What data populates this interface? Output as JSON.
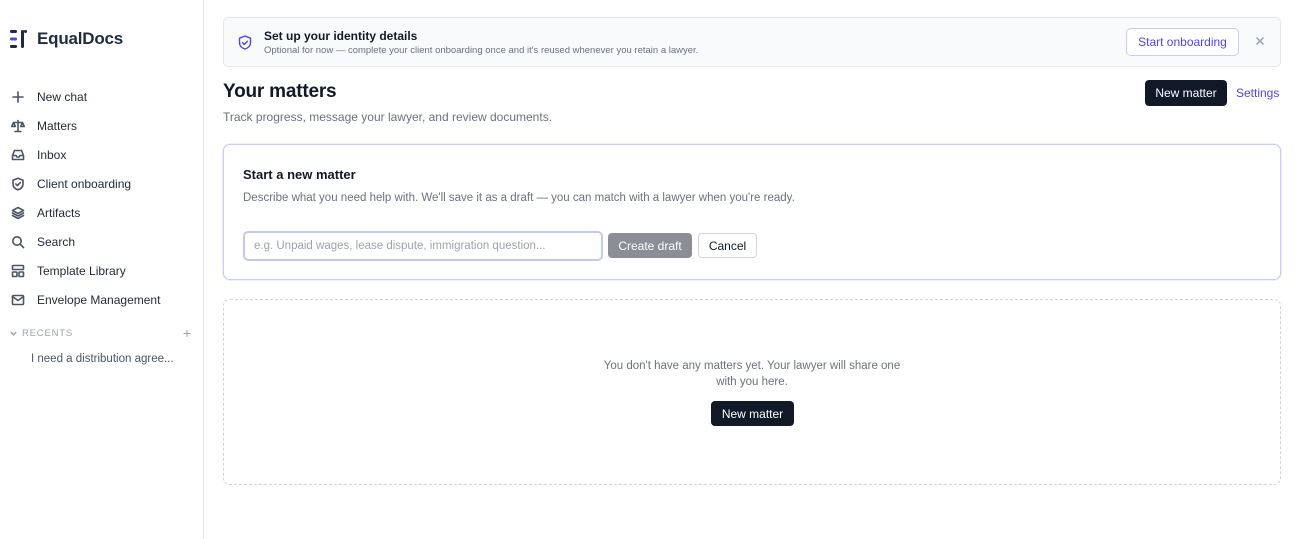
{
  "brand": {
    "name": "EqualDocs"
  },
  "sidebar": {
    "items": [
      {
        "label": "New chat",
        "icon": "plus-icon"
      },
      {
        "label": "Matters",
        "icon": "scale-icon"
      },
      {
        "label": "Inbox",
        "icon": "inbox-icon"
      },
      {
        "label": "Client onboarding",
        "icon": "shield-icon"
      },
      {
        "label": "Artifacts",
        "icon": "layers-icon"
      },
      {
        "label": "Search",
        "icon": "search-icon"
      },
      {
        "label": "Template Library",
        "icon": "template-icon"
      },
      {
        "label": "Envelope Management",
        "icon": "envelope-icon"
      }
    ],
    "recents_title": "RECENTS",
    "recents_add": "+",
    "recents": [
      {
        "label": "I need a distribution agree..."
      }
    ]
  },
  "banner": {
    "title": "Set up your identity details",
    "subtitle": "Optional for now — complete your client onboarding once and it's reused whenever you retain a lawyer.",
    "button_label": "Start onboarding",
    "icon": "shield-check-icon"
  },
  "header": {
    "title": "Your matters",
    "subtitle": "Track progress, message your lawyer, and review documents.",
    "new_matter_label": "New matter",
    "settings_label": "Settings"
  },
  "new_matter_card": {
    "title": "Start a new matter",
    "description": "Describe what you need help with. We'll save it as a draft — you can match with a lawyer when you're ready.",
    "input_placeholder": "e.g. Unpaid wages, lease dispute, immigration question...",
    "input_value": "",
    "create_label": "Create draft",
    "cancel_label": "Cancel"
  },
  "empty_state": {
    "message": "You don't have any matters yet. Your lawyer will share one with you here.",
    "button_label": "New matter"
  },
  "colors": {
    "accent": "#4f46e5",
    "dark_button": "#111827",
    "disabled_button": "#8b8e96",
    "brand": "#1f2a44"
  }
}
